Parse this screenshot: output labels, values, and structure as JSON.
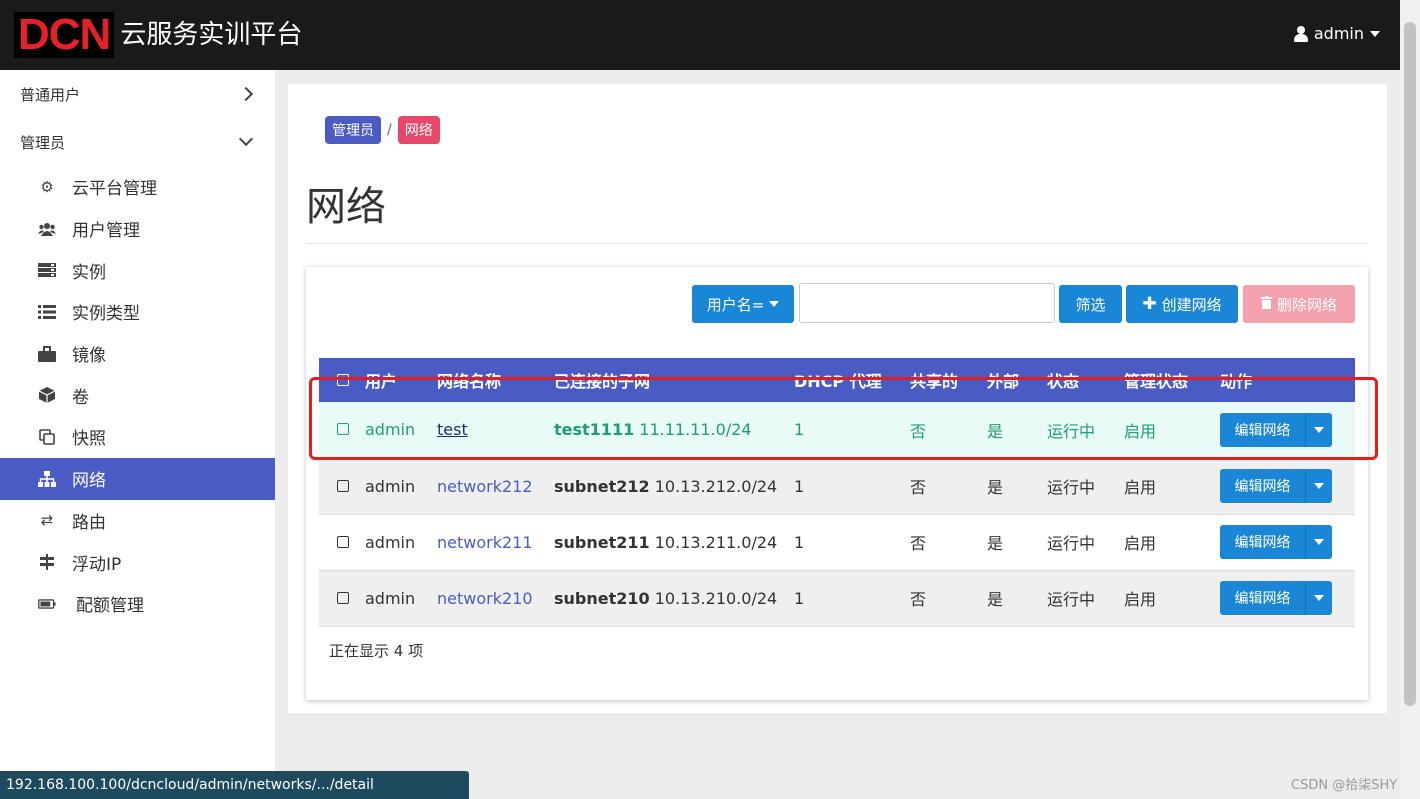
{
  "header": {
    "logo_mark": "DCN",
    "logo_text": "云服务实训平台",
    "user": "admin"
  },
  "sidebar": {
    "groups": [
      {
        "label": "普通用户"
      },
      {
        "label": "管理员"
      }
    ],
    "items": [
      {
        "label": "云平台管理",
        "icon": "gears-icon"
      },
      {
        "label": "用户管理",
        "icon": "users-icon"
      },
      {
        "label": "实例",
        "icon": "server-icon"
      },
      {
        "label": "实例类型",
        "icon": "list-icon"
      },
      {
        "label": "镜像",
        "icon": "briefcase-icon"
      },
      {
        "label": "卷",
        "icon": "cube-icon"
      },
      {
        "label": "快照",
        "icon": "copy-icon"
      },
      {
        "label": "网络",
        "icon": "sitemap-icon",
        "active": true
      },
      {
        "label": "路由",
        "icon": "random-icon"
      },
      {
        "label": "浮动IP",
        "icon": "signpost-icon"
      },
      {
        "label": "配额管理",
        "icon": "battery-icon"
      }
    ]
  },
  "breadcrumb": {
    "parent": "管理员",
    "sep": "/",
    "current": "网络"
  },
  "page_title": "网络",
  "toolbar": {
    "filter_field": "用户名=",
    "filter_value": "",
    "filter_button": "筛选",
    "create_button": "创建网络",
    "delete_button": "删除网络"
  },
  "table": {
    "headers": [
      "用户",
      "网络名称",
      "已连接的子网",
      "DHCP 代理",
      "共享的",
      "外部",
      "状态",
      "管理状态",
      "动作"
    ],
    "rows": [
      {
        "user": "admin",
        "network": "test",
        "subnet_name": "test1111",
        "subnet_cidr": "11.11.11.0/24",
        "dhcp": "1",
        "shared": "否",
        "external": "是",
        "status": "运行中",
        "admin_state": "启用",
        "action": "编辑网络"
      },
      {
        "user": "admin",
        "network": "network212",
        "subnet_name": "subnet212",
        "subnet_cidr": "10.13.212.0/24",
        "dhcp": "1",
        "shared": "否",
        "external": "是",
        "status": "运行中",
        "admin_state": "启用",
        "action": "编辑网络"
      },
      {
        "user": "admin",
        "network": "network211",
        "subnet_name": "subnet211",
        "subnet_cidr": "10.13.211.0/24",
        "dhcp": "1",
        "shared": "否",
        "external": "是",
        "status": "运行中",
        "admin_state": "启用",
        "action": "编辑网络"
      },
      {
        "user": "admin",
        "network": "network210",
        "subnet_name": "subnet210",
        "subnet_cidr": "10.13.210.0/24",
        "dhcp": "1",
        "shared": "否",
        "external": "是",
        "status": "运行中",
        "admin_state": "启用",
        "action": "编辑网络"
      }
    ],
    "footer": "正在显示 4 项"
  },
  "statusbar": {
    "url": "192.168.100.100/dcncloud/admin/networks/.../detail"
  },
  "watermark": "CSDN @拾柒SHY",
  "colors": {
    "accent": "#4a5bc4",
    "primary_button": "#1a86d6",
    "danger_button": "#f4a0ad",
    "highlight": "#e02020",
    "topbar": "#1a1a1a"
  }
}
